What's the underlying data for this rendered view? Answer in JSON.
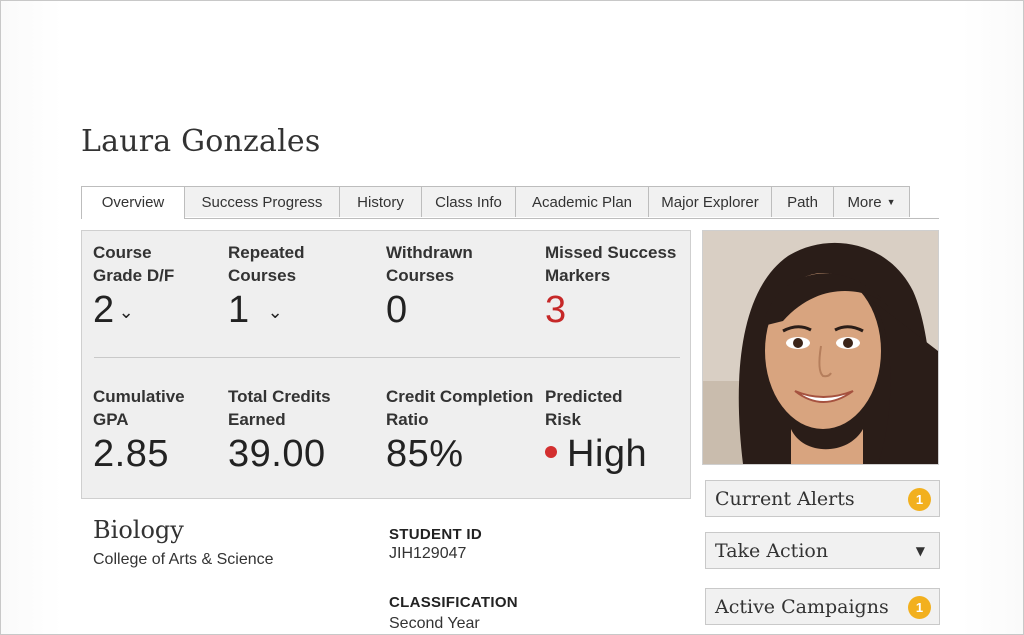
{
  "student": {
    "name": "Laura Gonzales"
  },
  "tabs": [
    {
      "label": "Overview"
    },
    {
      "label": "Success Progress"
    },
    {
      "label": "History"
    },
    {
      "label": "Class Info"
    },
    {
      "label": "Academic Plan"
    },
    {
      "label": "Major Explorer"
    },
    {
      "label": "Path"
    },
    {
      "label": "More"
    }
  ],
  "stats": {
    "course_grade": {
      "label_line1": "Course",
      "label_line2": "Grade D/F",
      "value": "2"
    },
    "repeated": {
      "label_line1": "Repeated",
      "label_line2": "Courses",
      "value": "1"
    },
    "withdrawn": {
      "label_line1": "Withdrawn",
      "label_line2": "Courses",
      "value": "0"
    },
    "missed": {
      "label_line1": "Missed Success",
      "label_line2": "Markers",
      "value": "3"
    },
    "gpa": {
      "label_line1": "Cumulative",
      "label_line2": "GPA",
      "value": "2.85"
    },
    "credits": {
      "label_line1": "Total Credits",
      "label_line2": "Earned",
      "value": "39.00"
    },
    "ratio": {
      "label_line1": "Credit Completion",
      "label_line2": "Ratio",
      "value": "85%"
    },
    "risk": {
      "label_line1": "Predicted",
      "label_line2": "Risk",
      "value": "High"
    }
  },
  "profile": {
    "major": "Biology",
    "college": "College of Arts & Science",
    "student_id_label": "STUDENT ID",
    "student_id": "JIH129047",
    "classification_label": "CLASSIFICATION",
    "classification": "Second Year"
  },
  "sidebar": {
    "current_alerts": {
      "label": "Current Alerts",
      "count": "1"
    },
    "take_action": {
      "label": "Take Action"
    },
    "active_campaigns": {
      "label": "Active Campaigns",
      "count": "1"
    }
  },
  "colors": {
    "risk_dot": "#d32f2f",
    "missed_value": "#c62828",
    "badge": "#f2b01e",
    "panel_bg": "#efefef"
  },
  "icons": {
    "chevron": "chevron-down-icon",
    "caret": "caret-down-icon",
    "risk": "risk-dot-icon"
  }
}
